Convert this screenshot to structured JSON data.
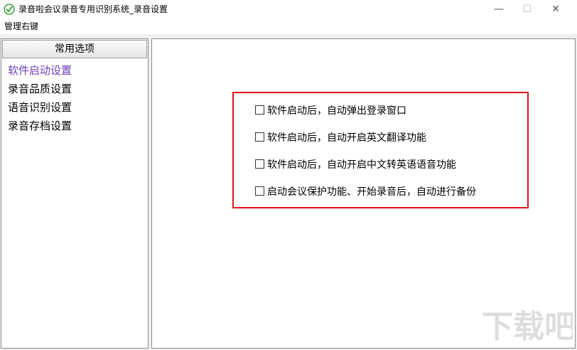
{
  "window": {
    "title": "录音啦会议录音专用识别系统_录音设置",
    "minimize": "—",
    "maximize": "☐",
    "close": "✕"
  },
  "menu": {
    "items": [
      {
        "label": "管理右键"
      }
    ]
  },
  "sidebar": {
    "header": "常用选项",
    "items": [
      {
        "label": "软件启动设置",
        "active": true
      },
      {
        "label": "录音品质设置",
        "active": false
      },
      {
        "label": "语音识别设置",
        "active": false
      },
      {
        "label": "录音存档设置",
        "active": false
      }
    ]
  },
  "settings": {
    "options": [
      {
        "label": "软件启动后，自动弹出登录窗口",
        "checked": false
      },
      {
        "label": "软件启动后，自动开启英文翻译功能",
        "checked": false
      },
      {
        "label": "软件启动后，自动开启中文转英语语音功能",
        "checked": false
      },
      {
        "label": "启动会议保护功能、开始录音后，自动进行备份",
        "checked": false
      }
    ]
  },
  "watermark": {
    "text": "下载吧"
  },
  "colors": {
    "highlight": "#e0131b",
    "active_nav": "#6a3fb5",
    "icon": "#3aa53a"
  }
}
